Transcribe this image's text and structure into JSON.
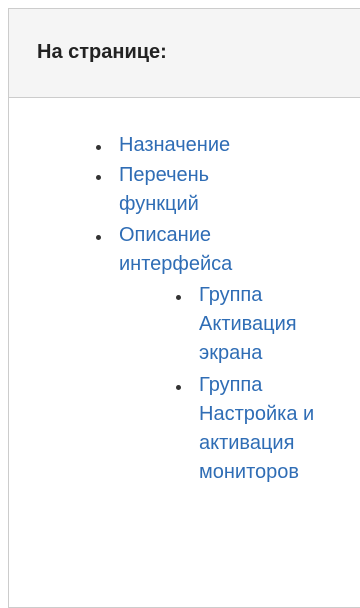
{
  "panel": {
    "title": "На странице:"
  },
  "toc": {
    "items": [
      {
        "label": "Назначение"
      },
      {
        "label": "Перечень функций"
      },
      {
        "label": "Описание интерфейса"
      },
      {
        "label": "Группа Активация экрана"
      },
      {
        "label": "Группа Настройка и активация мониторов"
      }
    ]
  },
  "colors": {
    "link": "#2f6db5",
    "header_bg": "#f5f5f5",
    "border": "#cccccc",
    "bullet": "#333333"
  }
}
